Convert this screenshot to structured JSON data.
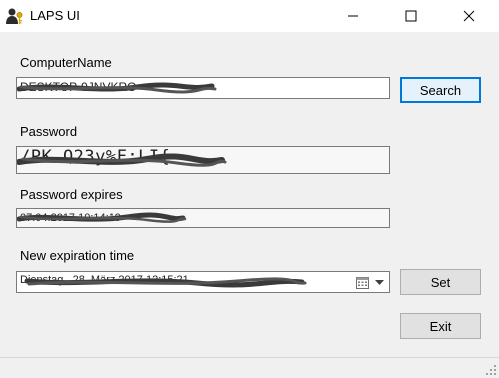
{
  "window": {
    "title": "LAPS UI",
    "icon": "laps-user-key-icon",
    "controls": [
      "minimize-icon",
      "maximize-icon",
      "close-icon"
    ]
  },
  "form": {
    "computer_name": {
      "label": "ComputerName",
      "value": "DESKTOP-9JNVKRO"
    },
    "search_button": "Search",
    "password": {
      "label": "Password",
      "value": "/PK.Q23y%F:LI{"
    },
    "password_expires": {
      "label": "Password expires",
      "value": "07.04.2017 10:14:19"
    },
    "new_expiration": {
      "label": "New expiration time",
      "value": "Dienstag , 28.     März      2017 12:15:21"
    },
    "set_button": "Set",
    "exit_button": "Exit"
  },
  "colors": {
    "accent": "#0078d7",
    "window_bg": "#f0f0f0",
    "redaction": "#3a3a3a"
  }
}
